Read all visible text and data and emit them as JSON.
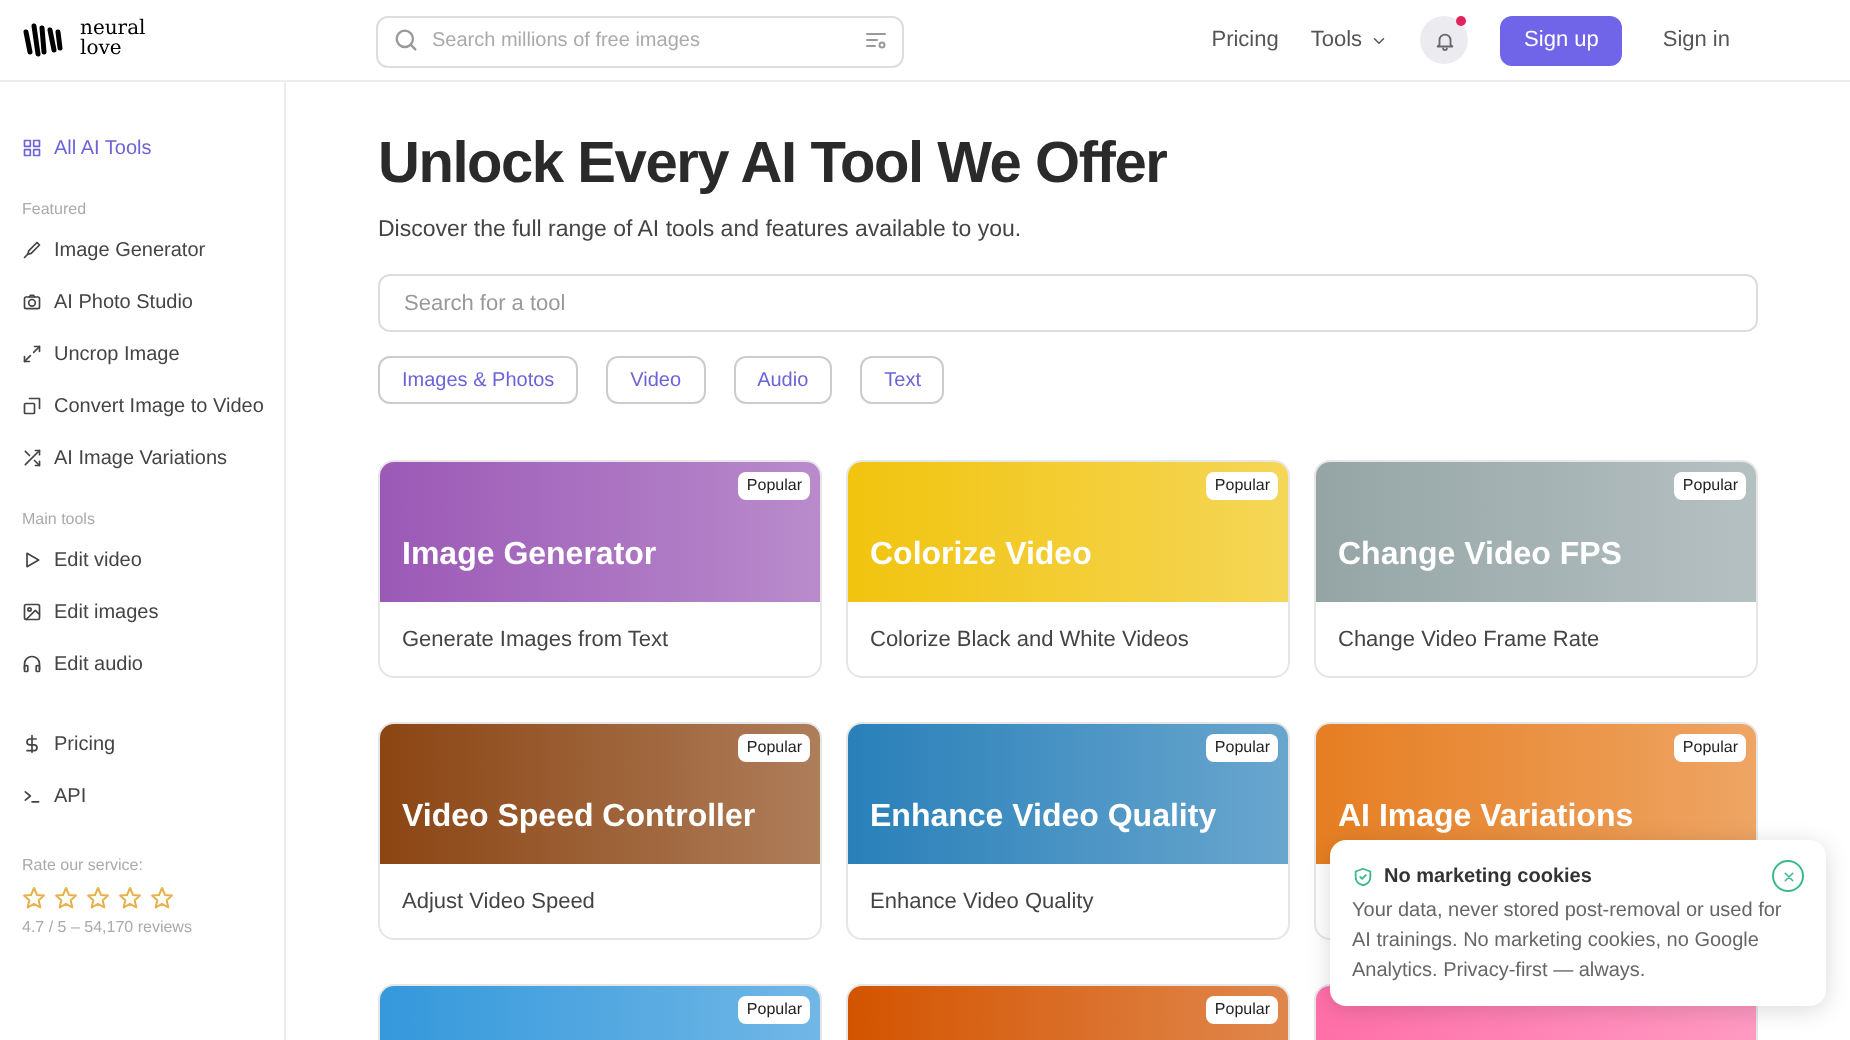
{
  "logo": {
    "text": "neural love"
  },
  "header": {
    "search_placeholder": "Search millions of free images",
    "nav": [
      {
        "label": "Pricing",
        "kind": "link"
      },
      {
        "label": "Tools",
        "kind": "dropdown"
      }
    ],
    "notification_dot": true,
    "sign_up": "Sign up",
    "sign_in": "Sign in"
  },
  "sidebar": {
    "top": {
      "label": "All AI Tools",
      "selected": true
    },
    "sections": [
      {
        "heading": "Featured",
        "items": [
          {
            "label": "Image Generator",
            "selected": false
          },
          {
            "label": "AI Photo Studio",
            "selected": false
          },
          {
            "label": "Uncrop Image",
            "selected": false
          },
          {
            "label": "Convert Image to Video",
            "selected": false
          },
          {
            "label": "AI Image Variations",
            "selected": false
          }
        ]
      },
      {
        "heading": "Main tools",
        "items": [
          {
            "label": "Edit video",
            "selected": false
          },
          {
            "label": "Edit images",
            "selected": false
          },
          {
            "label": "Edit audio",
            "selected": false
          }
        ]
      },
      {
        "items": [
          {
            "label": "Pricing",
            "selected": false
          },
          {
            "label": "API",
            "selected": false
          }
        ]
      }
    ],
    "rating": {
      "label": "Rate our service:",
      "stars": 0,
      "summary": "4.7 / 5 – 54,170 reviews"
    }
  },
  "main": {
    "title": "Unlock Every AI Tool We Offer",
    "subtitle": "Discover the full range of AI tools and features available to you.",
    "search_placeholder": "Search for a tool",
    "filters": [
      {
        "label": "Images & Photos",
        "selected": false
      },
      {
        "label": "Video",
        "selected": false
      },
      {
        "label": "Audio",
        "selected": false
      },
      {
        "label": "Text",
        "selected": false
      }
    ],
    "cards": [
      {
        "title": "Image Generator",
        "description": "Generate Images from Text",
        "badge": "Popular",
        "color": "#9b59b6"
      },
      {
        "title": "Colorize Video",
        "description": "Colorize Black and White Videos",
        "badge": "Popular",
        "color": "#f1c40f"
      },
      {
        "title": "Change Video FPS",
        "description": "Change Video Frame Rate",
        "badge": "Popular",
        "color": "#95a5a6"
      },
      {
        "title": "Video Speed Controller",
        "description": "Adjust Video Speed",
        "badge": "Popular",
        "color": "#8b4513"
      },
      {
        "title": "Enhance Video Quality",
        "description": "Enhance Video Quality",
        "badge": "Popular",
        "color": "#2980b9"
      },
      {
        "title": "AI Image Variations",
        "badge": "Popular",
        "color": "#e67e22"
      },
      {
        "badge": "Popular",
        "color": "#3498db"
      },
      {
        "badge": "Popular",
        "color": "#d35400"
      },
      {
        "color": "#ff6fa8"
      }
    ]
  },
  "cookie_notice": {
    "title": "No marketing cookies",
    "text": "Your data, never stored post-removal or used for AI trainings. No marketing cookies, no Google Analytics. Privacy-first — always."
  }
}
